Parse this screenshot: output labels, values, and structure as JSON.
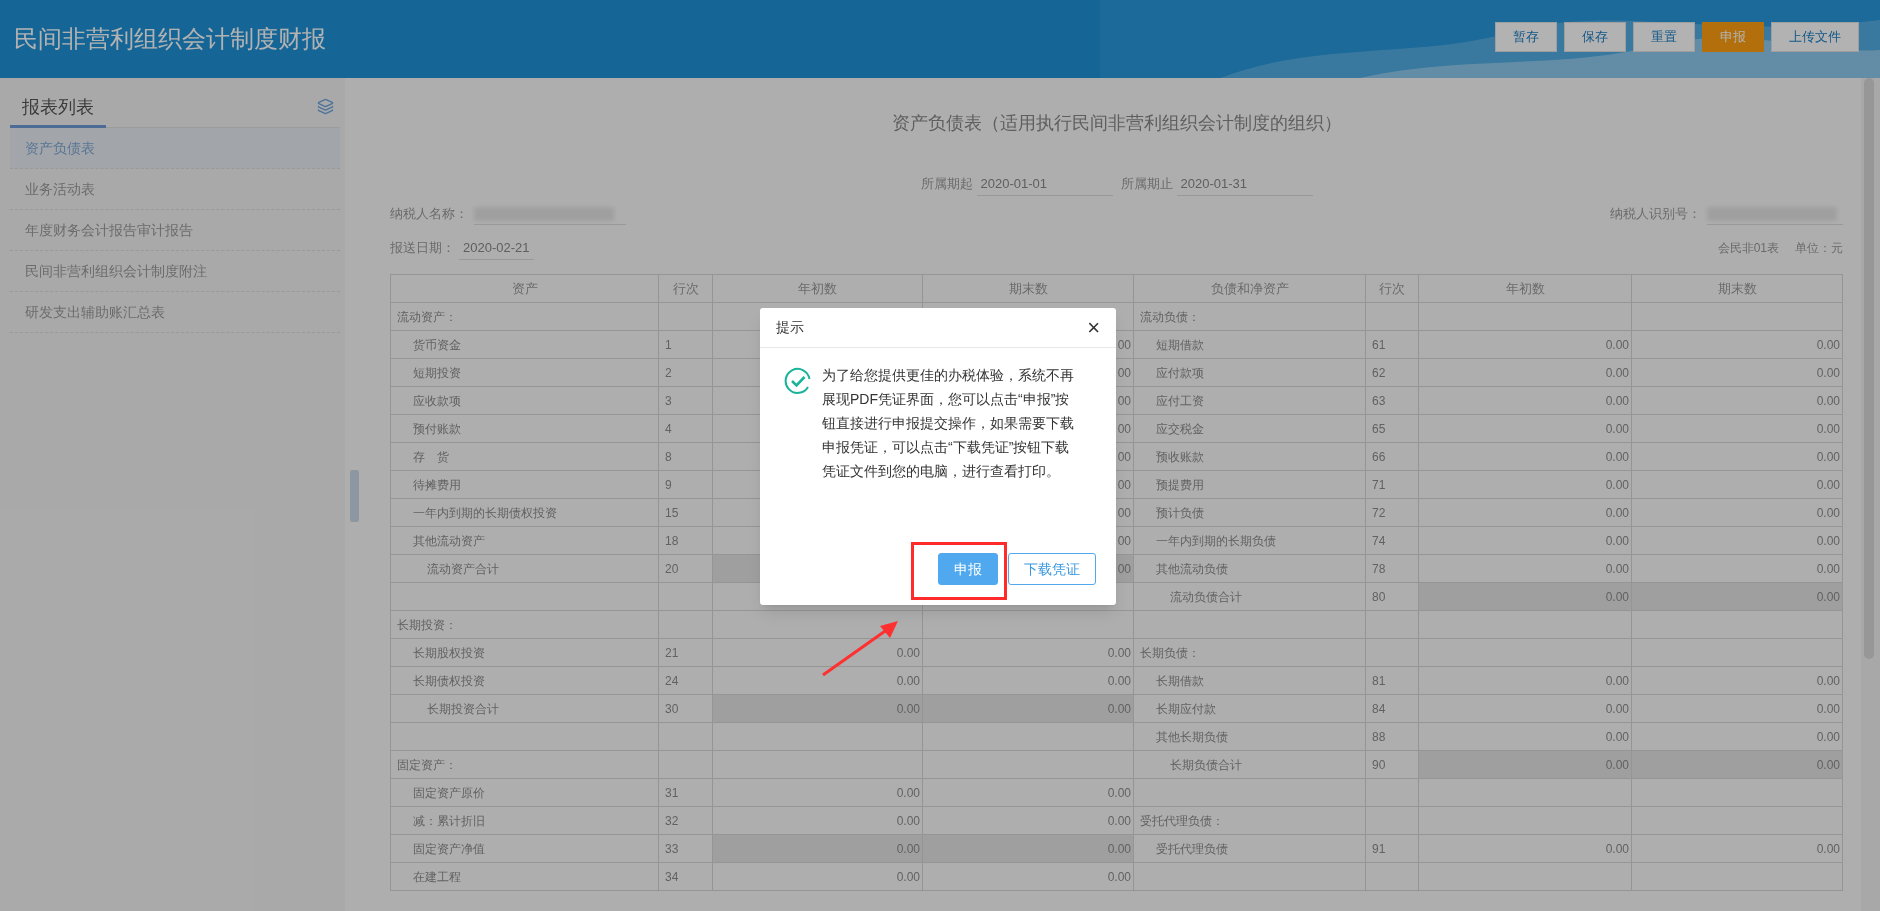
{
  "app_title": "民间非营利组织会计制度财报",
  "toolbar_buttons": [
    {
      "label": "暂存",
      "kind": "default"
    },
    {
      "label": "保存",
      "kind": "default"
    },
    {
      "label": "重置",
      "kind": "default"
    },
    {
      "label": "申报",
      "kind": "primary"
    },
    {
      "label": "上传文件",
      "kind": "default"
    }
  ],
  "sidebar": {
    "title": "报表列表",
    "items": [
      {
        "label": "资产负债表",
        "selected": true
      },
      {
        "label": "业务活动表",
        "selected": false
      },
      {
        "label": "年度财务会计报告审计报告",
        "selected": false
      },
      {
        "label": "民间非营利组织会计制度附注",
        "selected": false
      },
      {
        "label": "研发支出辅助账汇总表",
        "selected": false
      }
    ]
  },
  "report": {
    "title": "资产负债表（适用执行民间非营利组织会计制度的组织）",
    "period": [
      {
        "label": "所属期起",
        "value": "2020-01-01"
      },
      {
        "label": "所属期止",
        "value": "2020-01-31"
      }
    ],
    "taxpayer_name_label": "纳税人名称：",
    "taxpayer_id_label": "纳税人识别号：",
    "submit_date": {
      "label": "报送日期：",
      "value": "2020-02-21"
    },
    "form_code": "会民非01表",
    "unit": "单位：元",
    "columns": [
      "资产",
      "行次",
      "年初数",
      "期末数",
      "负债和净资产",
      "行次",
      "年初数",
      "期末数"
    ],
    "rows": [
      {
        "left": {
          "kind": "section",
          "label": "流动资产："
        },
        "right": {
          "kind": "section",
          "label": "流动负债："
        }
      },
      {
        "left": {
          "kind": "item",
          "label": "货币资金",
          "line": "1",
          "end": "00"
        },
        "right": {
          "kind": "item",
          "label": "短期借款",
          "line": "61",
          "begin": "0.00",
          "end": "0.00"
        }
      },
      {
        "left": {
          "kind": "item",
          "label": "短期投资",
          "line": "2",
          "end": "00"
        },
        "right": {
          "kind": "item",
          "label": "应付款项",
          "line": "62",
          "begin": "0.00",
          "end": "0.00"
        }
      },
      {
        "left": {
          "kind": "item",
          "label": "应收款项",
          "line": "3",
          "end": "00"
        },
        "right": {
          "kind": "item",
          "label": "应付工资",
          "line": "63",
          "begin": "0.00",
          "end": "0.00"
        }
      },
      {
        "left": {
          "kind": "item",
          "label": "预付账款",
          "line": "4",
          "end": "00"
        },
        "right": {
          "kind": "item",
          "label": "应交税金",
          "line": "65",
          "begin": "0.00",
          "end": "0.00"
        }
      },
      {
        "left": {
          "kind": "item",
          "label": "存　货",
          "line": "8",
          "end": "00"
        },
        "right": {
          "kind": "item",
          "label": "预收账款",
          "line": "66",
          "begin": "0.00",
          "end": "0.00"
        }
      },
      {
        "left": {
          "kind": "item",
          "label": "待摊费用",
          "line": "9",
          "end": "00"
        },
        "right": {
          "kind": "item",
          "label": "预提费用",
          "line": "71",
          "begin": "0.00",
          "end": "0.00"
        }
      },
      {
        "left": {
          "kind": "item",
          "label": "一年内到期的长期债权投资",
          "line": "15",
          "end": "00"
        },
        "right": {
          "kind": "item",
          "label": "预计负债",
          "line": "72",
          "begin": "0.00",
          "end": "0.00"
        }
      },
      {
        "left": {
          "kind": "item",
          "label": "其他流动资产",
          "line": "18",
          "end": "00"
        },
        "right": {
          "kind": "item",
          "label": "一年内到期的长期负债",
          "line": "74",
          "begin": "0.00",
          "end": "0.00"
        }
      },
      {
        "left": {
          "kind": "total",
          "label": "流动资产合计",
          "line": "20",
          "end": "00"
        },
        "right": {
          "kind": "item",
          "label": "其他流动负债",
          "line": "78",
          "begin": "0.00",
          "end": "0.00"
        }
      },
      {
        "left": {
          "kind": "blank"
        },
        "right": {
          "kind": "total",
          "label": "流动负债合计",
          "line": "80",
          "begin": "0.00",
          "end": "0.00"
        }
      },
      {
        "left": {
          "kind": "section",
          "label": "长期投资："
        },
        "right": {
          "kind": "blank"
        }
      },
      {
        "left": {
          "kind": "item",
          "label": "长期股权投资",
          "line": "21",
          "begin": "0.00",
          "end": "0.00"
        },
        "right": {
          "kind": "section",
          "label": "长期负债："
        }
      },
      {
        "left": {
          "kind": "item",
          "label": "长期债权投资",
          "line": "24",
          "begin": "0.00",
          "end": "0.00"
        },
        "right": {
          "kind": "item",
          "label": "长期借款",
          "line": "81",
          "begin": "0.00",
          "end": "0.00"
        }
      },
      {
        "left": {
          "kind": "total",
          "label": "长期投资合计",
          "line": "30",
          "begin": "0.00",
          "end": "0.00"
        },
        "right": {
          "kind": "item",
          "label": "长期应付款",
          "line": "84",
          "begin": "0.00",
          "end": "0.00"
        }
      },
      {
        "left": {
          "kind": "blank"
        },
        "right": {
          "kind": "item",
          "label": "其他长期负债",
          "line": "88",
          "begin": "0.00",
          "end": "0.00"
        }
      },
      {
        "left": {
          "kind": "section",
          "label": "固定资产："
        },
        "right": {
          "kind": "total",
          "label": "长期负债合计",
          "line": "90",
          "begin": "0.00",
          "end": "0.00"
        }
      },
      {
        "left": {
          "kind": "item",
          "label": "固定资产原价",
          "line": "31",
          "begin": "0.00",
          "end": "0.00"
        },
        "right": {
          "kind": "blank"
        }
      },
      {
        "left": {
          "kind": "item",
          "label": "减：累计折旧",
          "line": "32",
          "begin": "0.00",
          "end": "0.00"
        },
        "right": {
          "kind": "section",
          "label": "受托代理负债："
        }
      },
      {
        "left": {
          "kind": "computed",
          "label": "固定资产净值",
          "line": "33",
          "begin": "0.00",
          "end": "0.00"
        },
        "right": {
          "kind": "item",
          "label": "受托代理负债",
          "line": "91",
          "begin": "0.00",
          "end": "0.00"
        }
      },
      {
        "left": {
          "kind": "item",
          "label": "在建工程",
          "line": "34",
          "begin": "0.00",
          "end": "0.00"
        },
        "right": {
          "kind": "blank"
        }
      }
    ]
  },
  "dialog": {
    "title": "提示",
    "close": "×",
    "message": "为了给您提供更佳的办税体验，系统不再展现PDF凭证界面，您可以点击“申报”按钮直接进行申报提交操作，如果需要下载申报凭证，可以点击“下载凭证”按钮下载凭证文件到您的电脑，进行查看打印。",
    "buttons": [
      {
        "label": "申报",
        "kind": "primary"
      },
      {
        "label": "下载凭证",
        "kind": "outline"
      }
    ]
  }
}
